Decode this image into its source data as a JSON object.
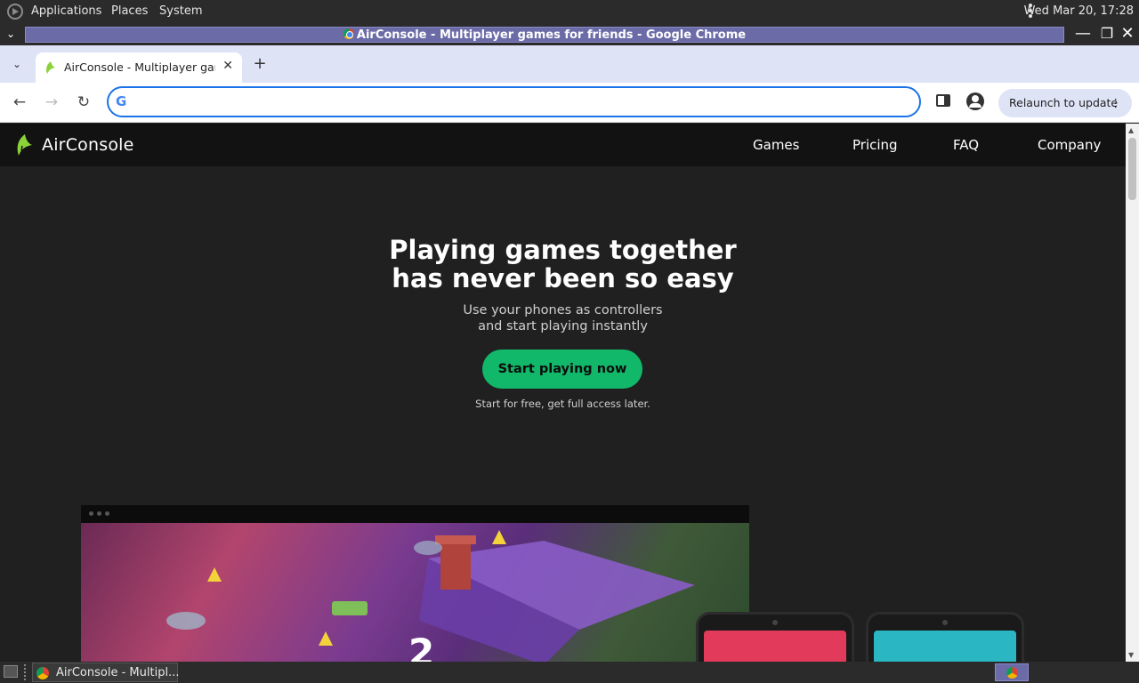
{
  "desktop": {
    "menu": [
      "Applications",
      "Places",
      "System"
    ],
    "clock": "Wed Mar 20, 17:28"
  },
  "window": {
    "title": "AirConsole - Multiplayer games for friends - Google Chrome"
  },
  "browser": {
    "tab_title": "AirConsole - Multiplayer games for friends",
    "omnibox_value": "",
    "relaunch_label": "Relaunch to update"
  },
  "site": {
    "logo_text": "AirConsole",
    "nav": [
      "Games",
      "Pricing",
      "FAQ",
      "Company"
    ],
    "hero_title_line1": "Playing games together",
    "hero_title_line2": "has never been so easy",
    "hero_sub_line1": "Use your phones as controllers",
    "hero_sub_line2": "and start playing instantly",
    "cta_label": "Start playing now",
    "cta_note": "Start for free, get full access later."
  },
  "taskbar": {
    "window_label": "AirConsole - Multipl..."
  },
  "colors": {
    "accent_green": "#12b86a",
    "page_bg": "#202020",
    "nav_bg": "#121212",
    "titlebar_active": "#6b6ba8"
  }
}
